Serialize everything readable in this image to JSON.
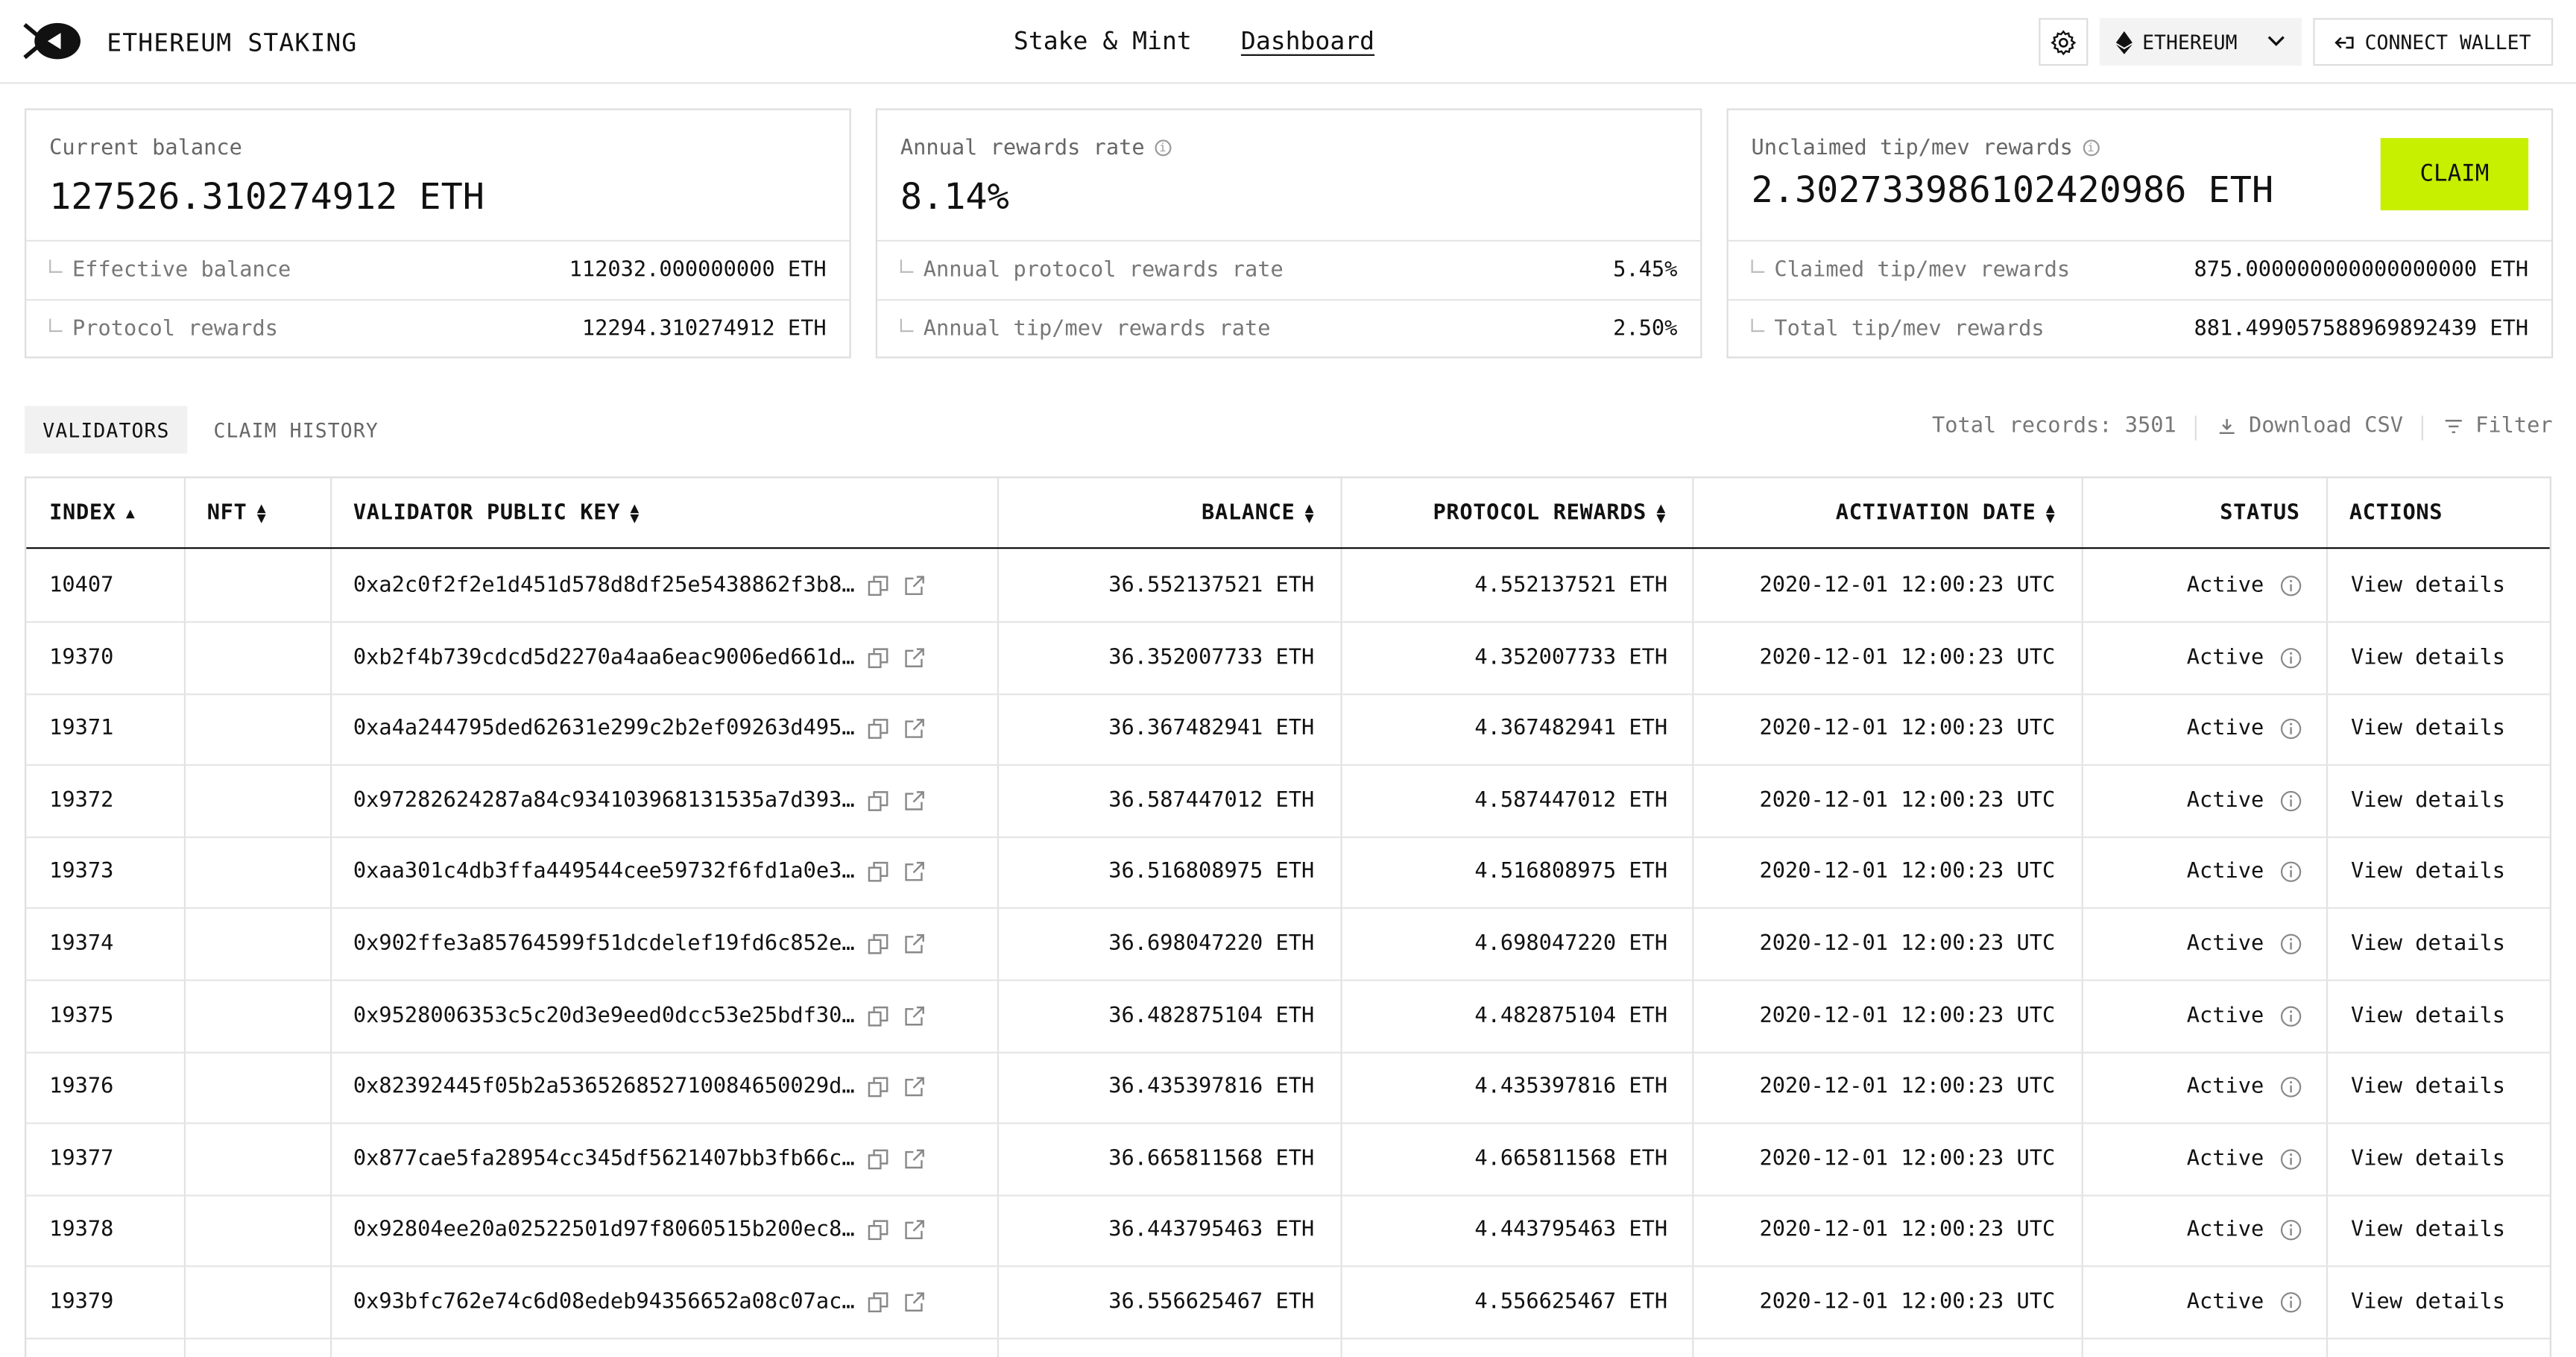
{
  "header": {
    "brand": "ETHEREUM STAKING",
    "nav": [
      {
        "label": "Stake & Mint"
      },
      {
        "label": "Dashboard"
      }
    ],
    "network_label": "ETHEREUM",
    "wallet_label": "CONNECT WALLET"
  },
  "stats": {
    "current_balance": {
      "label": "Current balance",
      "value": "127526.310274912 ETH"
    },
    "effective_balance": {
      "label": "Effective balance",
      "value": "112032.000000000 ETH"
    },
    "protocol_rewards": {
      "label": "Protocol rewards",
      "value": "12294.310274912 ETH"
    },
    "annual_rate": {
      "label": "Annual rewards rate",
      "value": "8.14%"
    },
    "annual_protocol_rate": {
      "label": "Annual protocol rewards rate",
      "value": "5.45%"
    },
    "annual_tip_rate": {
      "label": "Annual tip/mev rewards rate",
      "value": "2.50%"
    },
    "unclaimed": {
      "label": "Unclaimed tip/mev rewards",
      "value": "2.302733986102420986 ETH"
    },
    "claimed": {
      "label": "Claimed tip/mev rewards",
      "value": "875.000000000000000000 ETH"
    },
    "total_tip": {
      "label": "Total tip/mev rewards",
      "value": "881.499057588969892439 ETH"
    },
    "claim_label": "CLAIM"
  },
  "tabs": {
    "validators": "VALIDATORS",
    "history": "CLAIM HISTORY"
  },
  "toolbar": {
    "total": "Total records: 3501",
    "download": "Download CSV",
    "filter": "Filter"
  },
  "table": {
    "headers": [
      "INDEX",
      "NFT",
      "VALIDATOR PUBLIC KEY",
      "BALANCE",
      "PROTOCOL REWARDS",
      "ACTIVATION DATE",
      "STATUS",
      "ACTIONS"
    ],
    "rows": [
      {
        "index": "10407",
        "key": "0xa2c0f2f2e1d451d578d8df25e5438862f3b8…",
        "balance": "36.552137521 ETH",
        "rewards": "4.552137521 ETH",
        "date": "2020-12-01 12:00:23 UTC",
        "status": "Active",
        "action": "View details"
      },
      {
        "index": "19370",
        "key": "0xb2f4b739cdcd5d2270a4aa6eac9006ed661d…",
        "balance": "36.352007733 ETH",
        "rewards": "4.352007733 ETH",
        "date": "2020-12-01 12:00:23 UTC",
        "status": "Active",
        "action": "View details"
      },
      {
        "index": "19371",
        "key": "0xa4a244795ded62631e299c2b2ef09263d495…",
        "balance": "36.367482941 ETH",
        "rewards": "4.367482941 ETH",
        "date": "2020-12-01 12:00:23 UTC",
        "status": "Active",
        "action": "View details"
      },
      {
        "index": "19372",
        "key": "0x97282624287a84c934103968131535a7d393…",
        "balance": "36.587447012 ETH",
        "rewards": "4.587447012 ETH",
        "date": "2020-12-01 12:00:23 UTC",
        "status": "Active",
        "action": "View details"
      },
      {
        "index": "19373",
        "key": "0xaa301c4db3ffa449544cee59732f6fd1a0e3…",
        "balance": "36.516808975 ETH",
        "rewards": "4.516808975 ETH",
        "date": "2020-12-01 12:00:23 UTC",
        "status": "Active",
        "action": "View details"
      },
      {
        "index": "19374",
        "key": "0x902ffe3a85764599f51dcdelef19fd6c852e…",
        "balance": "36.698047220 ETH",
        "rewards": "4.698047220 ETH",
        "date": "2020-12-01 12:00:23 UTC",
        "status": "Active",
        "action": "View details"
      },
      {
        "index": "19375",
        "key": "0x9528006353c5c20d3e9eed0dcc53e25bdf30…",
        "balance": "36.482875104 ETH",
        "rewards": "4.482875104 ETH",
        "date": "2020-12-01 12:00:23 UTC",
        "status": "Active",
        "action": "View details"
      },
      {
        "index": "19376",
        "key": "0x82392445f05b2a536526852710084650029d…",
        "balance": "36.435397816 ETH",
        "rewards": "4.435397816 ETH",
        "date": "2020-12-01 12:00:23 UTC",
        "status": "Active",
        "action": "View details"
      },
      {
        "index": "19377",
        "key": "0x877cae5fa28954cc345df5621407bb3fb66c…",
        "balance": "36.665811568 ETH",
        "rewards": "4.665811568 ETH",
        "date": "2020-12-01 12:00:23 UTC",
        "status": "Active",
        "action": "View details"
      },
      {
        "index": "19378",
        "key": "0x92804ee20a02522501d97f8060515b200ec8…",
        "balance": "36.443795463 ETH",
        "rewards": "4.443795463 ETH",
        "date": "2020-12-01 12:00:23 UTC",
        "status": "Active",
        "action": "View details"
      },
      {
        "index": "19379",
        "key": "0x93bfc762e74c6d08edeb94356652a08c07ac…",
        "balance": "36.556625467 ETH",
        "rewards": "4.556625467 ETH",
        "date": "2020-12-01 12:00:23 UTC",
        "status": "Active",
        "action": "View details"
      }
    ]
  }
}
